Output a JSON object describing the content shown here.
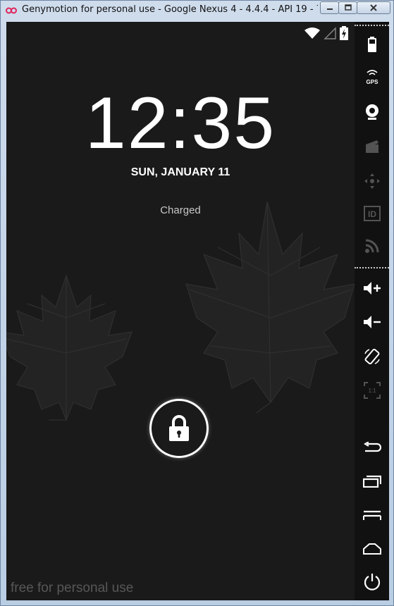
{
  "window": {
    "title": "Genymotion for personal use - Google Nexus 4 - 4.4.4 - API 19 - 76...",
    "controls": [
      "minimize",
      "maximize",
      "close"
    ]
  },
  "status_bar": {
    "icons": [
      "wifi-icon",
      "signal-icon",
      "battery-charging-icon"
    ]
  },
  "lockscreen": {
    "time": "12:35",
    "date": "SUN, JANUARY 11",
    "battery_status": "Charged",
    "lock_icon": "lock-icon"
  },
  "watermark": "free for personal use",
  "sidebar": {
    "top_tools": [
      {
        "id": "battery",
        "icon": "battery-icon",
        "enabled": true
      },
      {
        "id": "gps",
        "label": "GPS",
        "icon": "gps-icon",
        "enabled": true
      },
      {
        "id": "camera",
        "icon": "webcam-icon",
        "enabled": true
      },
      {
        "id": "capture",
        "icon": "clapper-icon",
        "enabled": false
      },
      {
        "id": "remote-control",
        "icon": "dpad-icon",
        "enabled": false
      },
      {
        "id": "identifiers",
        "label": "ID",
        "icon": "id-icon",
        "enabled": false
      },
      {
        "id": "network",
        "icon": "rss-icon",
        "enabled": false
      }
    ],
    "bottom_tools": [
      {
        "id": "volume-up",
        "icon": "volume-up-icon",
        "enabled": true
      },
      {
        "id": "volume-down",
        "icon": "volume-down-icon",
        "enabled": true
      },
      {
        "id": "rotate",
        "icon": "rotate-icon",
        "enabled": true
      },
      {
        "id": "pixel-perfect",
        "label": "1:1",
        "icon": "pixel-perfect-icon",
        "enabled": false
      },
      {
        "id": "back",
        "icon": "back-icon",
        "enabled": true
      },
      {
        "id": "recent-apps",
        "icon": "recent-apps-icon",
        "enabled": true
      },
      {
        "id": "menu",
        "icon": "menu-icon",
        "enabled": true
      },
      {
        "id": "home",
        "icon": "home-icon",
        "enabled": true
      },
      {
        "id": "power",
        "icon": "power-icon",
        "enabled": true
      }
    ]
  }
}
